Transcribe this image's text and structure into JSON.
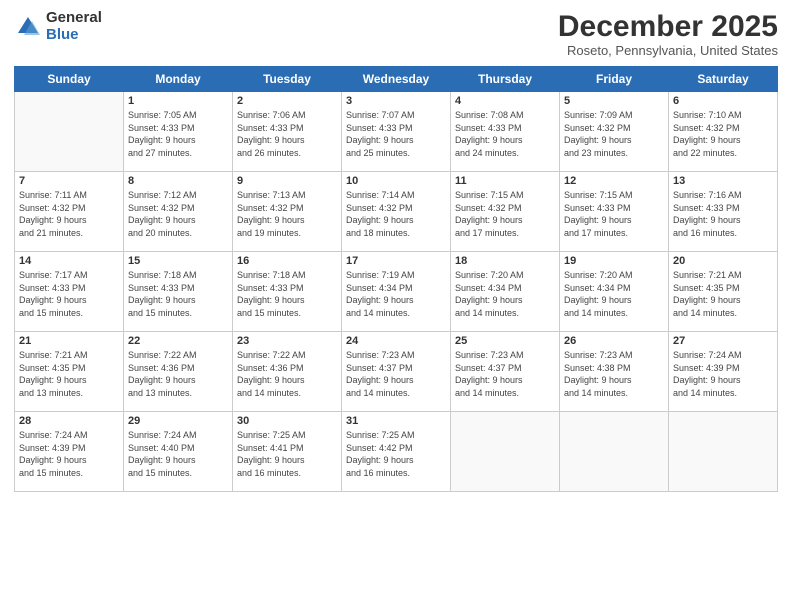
{
  "logo": {
    "general": "General",
    "blue": "Blue"
  },
  "title": "December 2025",
  "location": "Roseto, Pennsylvania, United States",
  "days_of_week": [
    "Sunday",
    "Monday",
    "Tuesday",
    "Wednesday",
    "Thursday",
    "Friday",
    "Saturday"
  ],
  "weeks": [
    [
      {
        "num": "",
        "info": ""
      },
      {
        "num": "1",
        "info": "Sunrise: 7:05 AM\nSunset: 4:33 PM\nDaylight: 9 hours\nand 27 minutes."
      },
      {
        "num": "2",
        "info": "Sunrise: 7:06 AM\nSunset: 4:33 PM\nDaylight: 9 hours\nand 26 minutes."
      },
      {
        "num": "3",
        "info": "Sunrise: 7:07 AM\nSunset: 4:33 PM\nDaylight: 9 hours\nand 25 minutes."
      },
      {
        "num": "4",
        "info": "Sunrise: 7:08 AM\nSunset: 4:33 PM\nDaylight: 9 hours\nand 24 minutes."
      },
      {
        "num": "5",
        "info": "Sunrise: 7:09 AM\nSunset: 4:32 PM\nDaylight: 9 hours\nand 23 minutes."
      },
      {
        "num": "6",
        "info": "Sunrise: 7:10 AM\nSunset: 4:32 PM\nDaylight: 9 hours\nand 22 minutes."
      }
    ],
    [
      {
        "num": "7",
        "info": "Sunrise: 7:11 AM\nSunset: 4:32 PM\nDaylight: 9 hours\nand 21 minutes."
      },
      {
        "num": "8",
        "info": "Sunrise: 7:12 AM\nSunset: 4:32 PM\nDaylight: 9 hours\nand 20 minutes."
      },
      {
        "num": "9",
        "info": "Sunrise: 7:13 AM\nSunset: 4:32 PM\nDaylight: 9 hours\nand 19 minutes."
      },
      {
        "num": "10",
        "info": "Sunrise: 7:14 AM\nSunset: 4:32 PM\nDaylight: 9 hours\nand 18 minutes."
      },
      {
        "num": "11",
        "info": "Sunrise: 7:15 AM\nSunset: 4:32 PM\nDaylight: 9 hours\nand 17 minutes."
      },
      {
        "num": "12",
        "info": "Sunrise: 7:15 AM\nSunset: 4:33 PM\nDaylight: 9 hours\nand 17 minutes."
      },
      {
        "num": "13",
        "info": "Sunrise: 7:16 AM\nSunset: 4:33 PM\nDaylight: 9 hours\nand 16 minutes."
      }
    ],
    [
      {
        "num": "14",
        "info": "Sunrise: 7:17 AM\nSunset: 4:33 PM\nDaylight: 9 hours\nand 15 minutes."
      },
      {
        "num": "15",
        "info": "Sunrise: 7:18 AM\nSunset: 4:33 PM\nDaylight: 9 hours\nand 15 minutes."
      },
      {
        "num": "16",
        "info": "Sunrise: 7:18 AM\nSunset: 4:33 PM\nDaylight: 9 hours\nand 15 minutes."
      },
      {
        "num": "17",
        "info": "Sunrise: 7:19 AM\nSunset: 4:34 PM\nDaylight: 9 hours\nand 14 minutes."
      },
      {
        "num": "18",
        "info": "Sunrise: 7:20 AM\nSunset: 4:34 PM\nDaylight: 9 hours\nand 14 minutes."
      },
      {
        "num": "19",
        "info": "Sunrise: 7:20 AM\nSunset: 4:34 PM\nDaylight: 9 hours\nand 14 minutes."
      },
      {
        "num": "20",
        "info": "Sunrise: 7:21 AM\nSunset: 4:35 PM\nDaylight: 9 hours\nand 14 minutes."
      }
    ],
    [
      {
        "num": "21",
        "info": "Sunrise: 7:21 AM\nSunset: 4:35 PM\nDaylight: 9 hours\nand 13 minutes."
      },
      {
        "num": "22",
        "info": "Sunrise: 7:22 AM\nSunset: 4:36 PM\nDaylight: 9 hours\nand 13 minutes."
      },
      {
        "num": "23",
        "info": "Sunrise: 7:22 AM\nSunset: 4:36 PM\nDaylight: 9 hours\nand 14 minutes."
      },
      {
        "num": "24",
        "info": "Sunrise: 7:23 AM\nSunset: 4:37 PM\nDaylight: 9 hours\nand 14 minutes."
      },
      {
        "num": "25",
        "info": "Sunrise: 7:23 AM\nSunset: 4:37 PM\nDaylight: 9 hours\nand 14 minutes."
      },
      {
        "num": "26",
        "info": "Sunrise: 7:23 AM\nSunset: 4:38 PM\nDaylight: 9 hours\nand 14 minutes."
      },
      {
        "num": "27",
        "info": "Sunrise: 7:24 AM\nSunset: 4:39 PM\nDaylight: 9 hours\nand 14 minutes."
      }
    ],
    [
      {
        "num": "28",
        "info": "Sunrise: 7:24 AM\nSunset: 4:39 PM\nDaylight: 9 hours\nand 15 minutes."
      },
      {
        "num": "29",
        "info": "Sunrise: 7:24 AM\nSunset: 4:40 PM\nDaylight: 9 hours\nand 15 minutes."
      },
      {
        "num": "30",
        "info": "Sunrise: 7:25 AM\nSunset: 4:41 PM\nDaylight: 9 hours\nand 16 minutes."
      },
      {
        "num": "31",
        "info": "Sunrise: 7:25 AM\nSunset: 4:42 PM\nDaylight: 9 hours\nand 16 minutes."
      },
      {
        "num": "",
        "info": ""
      },
      {
        "num": "",
        "info": ""
      },
      {
        "num": "",
        "info": ""
      }
    ]
  ]
}
